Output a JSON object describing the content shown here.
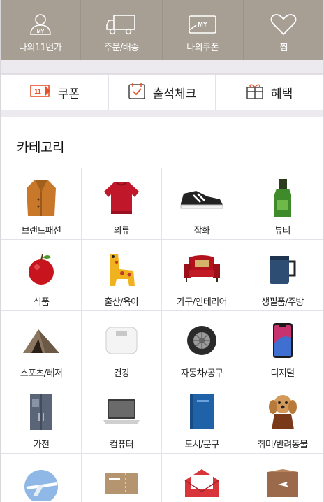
{
  "topnav": {
    "items": [
      {
        "label": "나의11번가",
        "icon": "my-person-icon",
        "badge": "MY"
      },
      {
        "label": "주문/배송",
        "icon": "delivery-truck-icon"
      },
      {
        "label": "나의쿠폰",
        "icon": "my-coupon-icon",
        "badge": "MY"
      },
      {
        "label": "찜",
        "icon": "heart-icon"
      }
    ]
  },
  "quickmenu": {
    "items": [
      {
        "label": "쿠폰",
        "icon": "coupon-icon",
        "icon_text": "11"
      },
      {
        "label": "출석체크",
        "icon": "calendar-check-icon"
      },
      {
        "label": "혜택",
        "icon": "gift-icon"
      }
    ]
  },
  "category": {
    "title": "카테고리",
    "items": [
      {
        "label": "브랜드패션",
        "icon": "coat-icon"
      },
      {
        "label": "의류",
        "icon": "sweater-icon"
      },
      {
        "label": "잡화",
        "icon": "sneaker-icon"
      },
      {
        "label": "뷰티",
        "icon": "cosmetic-bottle-icon"
      },
      {
        "label": "식품",
        "icon": "apple-icon"
      },
      {
        "label": "출산/육아",
        "icon": "giraffe-toy-icon"
      },
      {
        "label": "가구/인테리어",
        "icon": "armchair-icon"
      },
      {
        "label": "생필품/주방",
        "icon": "mug-icon"
      },
      {
        "label": "스포츠/레저",
        "icon": "tent-icon"
      },
      {
        "label": "건강",
        "icon": "scale-icon"
      },
      {
        "label": "자동차/공구",
        "icon": "tire-icon"
      },
      {
        "label": "디지털",
        "icon": "smartphone-icon"
      },
      {
        "label": "가전",
        "icon": "refrigerator-icon"
      },
      {
        "label": "컴퓨터",
        "icon": "laptop-icon"
      },
      {
        "label": "도서/문구",
        "icon": "book-icon"
      },
      {
        "label": "취미/반려동물",
        "icon": "dog-icon"
      },
      {
        "label": "",
        "icon": "airplane-icon"
      },
      {
        "label": "",
        "icon": "ticket-icon"
      },
      {
        "label": "",
        "icon": "envelope-icon"
      },
      {
        "label": "",
        "icon": "travel-box-icon"
      }
    ]
  },
  "colors": {
    "topnav_bg": "#a79e94",
    "divider": "#eceaee",
    "coupon_accent": "#e8522b"
  }
}
